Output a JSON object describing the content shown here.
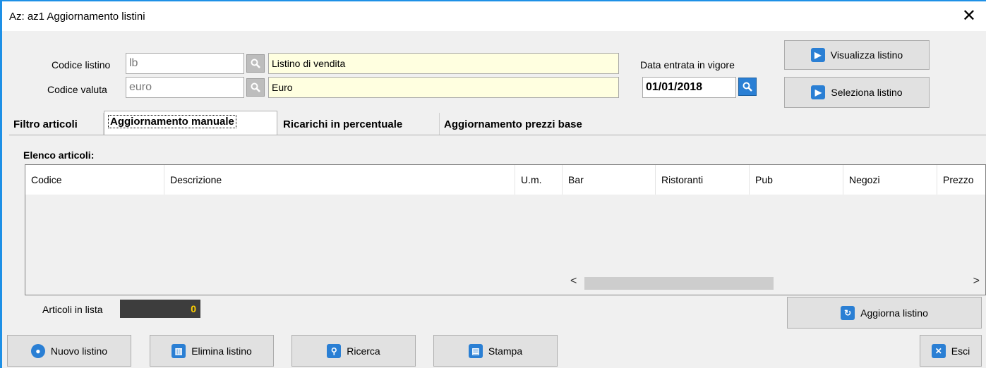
{
  "window": {
    "title": "Az: az1   Aggiornamento listini",
    "close_glyph": "✕"
  },
  "header": {
    "codice_listino_label": "Codice listino",
    "codice_listino_value": "lb",
    "listino_desc": "Listino di vendita",
    "codice_valuta_label": "Codice valuta",
    "codice_valuta_value": "euro",
    "valuta_desc": "Euro",
    "data_label": "Data entrata in vigore",
    "data_value": "01/01/2018",
    "visualizza_label": "Visualizza listino",
    "seleziona_label": "Seleziona listino"
  },
  "tabs": [
    {
      "label": "Filtro articoli"
    },
    {
      "label": "Aggiornamento manuale"
    },
    {
      "label": "Ricarichi in percentuale"
    },
    {
      "label": "Aggiornamento prezzi base"
    }
  ],
  "panel": {
    "list_title": "Elenco articoli:",
    "columns": [
      "Codice",
      "Descrizione",
      "U.m.",
      "Bar",
      "Ristoranti",
      "Pub",
      "Negozi",
      "Prezzo"
    ],
    "count_label": "Articoli in lista",
    "count_value": "0",
    "aggiorna_label": "Aggiorna listino"
  },
  "footer": {
    "nuovo_label": "Nuovo listino",
    "elimina_label": "Elimina listino",
    "ricerca_label": "Ricerca",
    "stampa_label": "Stampa",
    "esci_label": "Esci"
  },
  "colors": {
    "accent": "#1e90e6",
    "readonly_bg": "#ffffe0",
    "counter_text": "#ffd000"
  },
  "icons": [
    "search-icon",
    "play-icon",
    "refresh-icon",
    "trash-icon",
    "printer-icon",
    "close-icon",
    "new-icon"
  ]
}
